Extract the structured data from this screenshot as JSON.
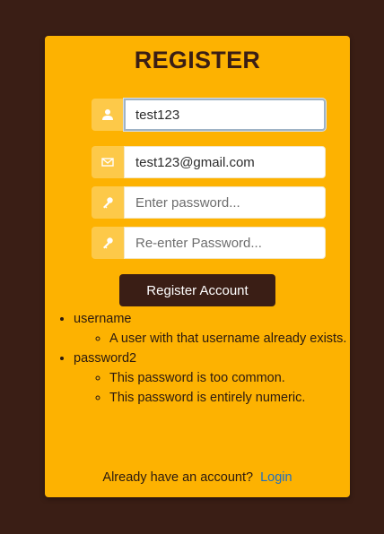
{
  "form": {
    "title": "REGISTER",
    "username": {
      "value": "test123",
      "placeholder": ""
    },
    "email": {
      "value": "test123@gmail.com",
      "placeholder": ""
    },
    "password": {
      "value": "",
      "placeholder": "Enter password..."
    },
    "password2": {
      "value": "",
      "placeholder": "Re-enter Password..."
    },
    "submit_label": "Register Account"
  },
  "errors": [
    {
      "field": "username",
      "messages": [
        "A user with that username already exists."
      ]
    },
    {
      "field": "password2",
      "messages": [
        "This password is too common.",
        "This password is entirely numeric."
      ]
    }
  ],
  "footer": {
    "text": "Already have an account?",
    "link_label": "Login"
  },
  "icons": {
    "username": "user-icon",
    "email": "envelope-icon",
    "password": "key-icon",
    "password2": "key-icon"
  },
  "colors": {
    "background": "#3a1e15",
    "card": "#fdb201",
    "addon": "#fdc949",
    "button": "#3a1e15",
    "link": "#1f6fc0"
  }
}
